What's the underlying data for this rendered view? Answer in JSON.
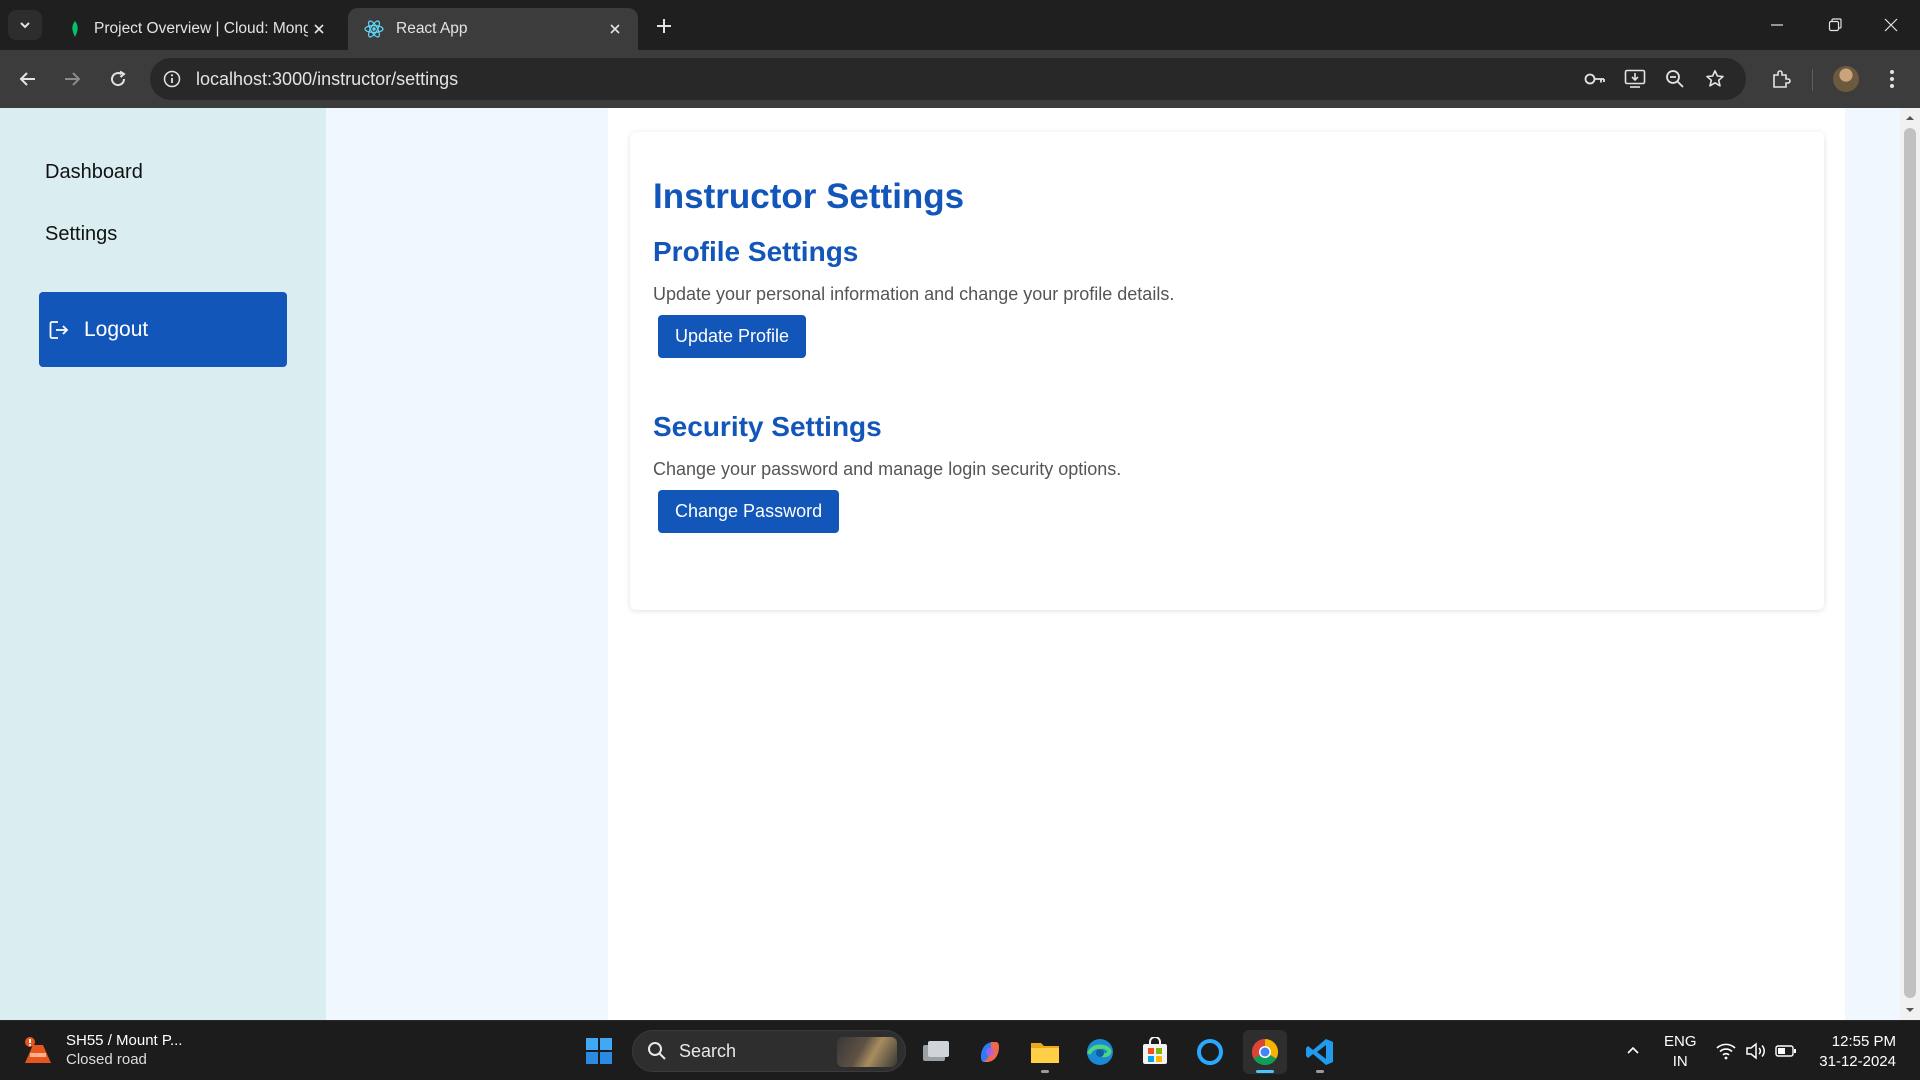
{
  "browser": {
    "tabs": [
      {
        "title": "Project Overview | Cloud: Mong",
        "icon": "mongodb-leaf-icon",
        "active": false
      },
      {
        "title": "React App",
        "icon": "react-icon",
        "active": true
      }
    ],
    "url": "localhost:3000/instructor/settings"
  },
  "sidebar": {
    "items": [
      {
        "label": "Dashboard"
      },
      {
        "label": "Settings"
      }
    ],
    "logout_label": "Logout",
    "logout_icon": "logout-icon"
  },
  "main": {
    "title": "Instructor Settings",
    "sections": [
      {
        "heading": "Profile Settings",
        "description": "Update your personal information and change your profile details.",
        "button": "Update Profile"
      },
      {
        "heading": "Security Settings",
        "description": "Change your password and manage login security options.",
        "button": "Change Password"
      }
    ]
  },
  "taskbar": {
    "weather_title": "SH55 / Mount P...",
    "weather_subtitle": "Closed road",
    "search_label": "Search",
    "lang_line1": "ENG",
    "lang_line2": "IN",
    "time": "12:55 PM",
    "date": "31-12-2024"
  },
  "colors": {
    "accent": "#1356b9",
    "sidebar_bg": "#daeef2",
    "gutter_bg": "#f0f7fe"
  }
}
